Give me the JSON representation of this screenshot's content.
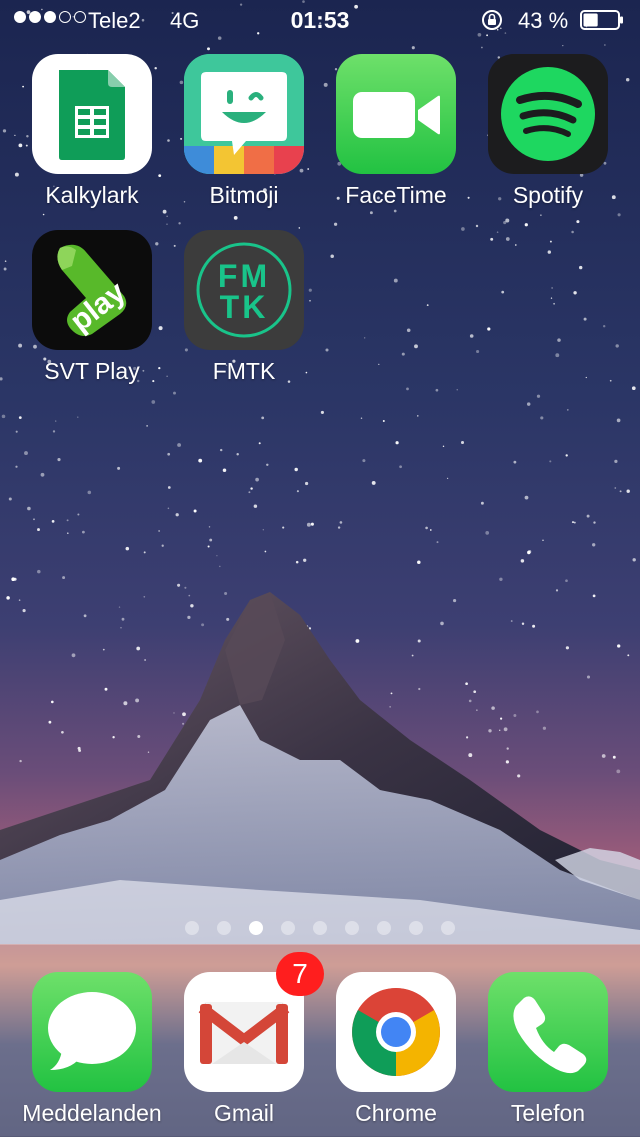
{
  "status_bar": {
    "carrier": "Tele2",
    "network": "4G",
    "time": "01:53",
    "battery_percent": "43 %",
    "battery_level": 0.43,
    "signal_bars_filled": 3,
    "signal_bars_total": 5,
    "orientation_lock_icon": "rotation-lock-icon"
  },
  "home_apps": [
    {
      "label": "Kalkylark",
      "icon": "sheets-icon"
    },
    {
      "label": "Bitmoji",
      "icon": "bitmoji-icon"
    },
    {
      "label": "FaceTime",
      "icon": "facetime-icon"
    },
    {
      "label": "Spotify",
      "icon": "spotify-icon"
    },
    {
      "label": "SVT Play",
      "icon": "svt-play-icon",
      "icon_text": "play"
    },
    {
      "label": "FMTK",
      "icon": "fmtk-icon",
      "icon_text": "FM\nTK"
    }
  ],
  "page_indicator": {
    "count": 9,
    "active_index": 2
  },
  "dock_apps": [
    {
      "label": "Meddelanden",
      "icon": "messages-icon"
    },
    {
      "label": "Gmail",
      "icon": "gmail-icon",
      "badge": "7"
    },
    {
      "label": "Chrome",
      "icon": "chrome-icon"
    },
    {
      "label": "Telefon",
      "icon": "phone-icon"
    }
  ],
  "colors": {
    "spotify_green": "#1ed760",
    "facetime_green": "#3fd25a",
    "sheets_green": "#0f9d58",
    "fmtk_teal": "#19c48a",
    "badge_red": "#ff1e1e"
  }
}
